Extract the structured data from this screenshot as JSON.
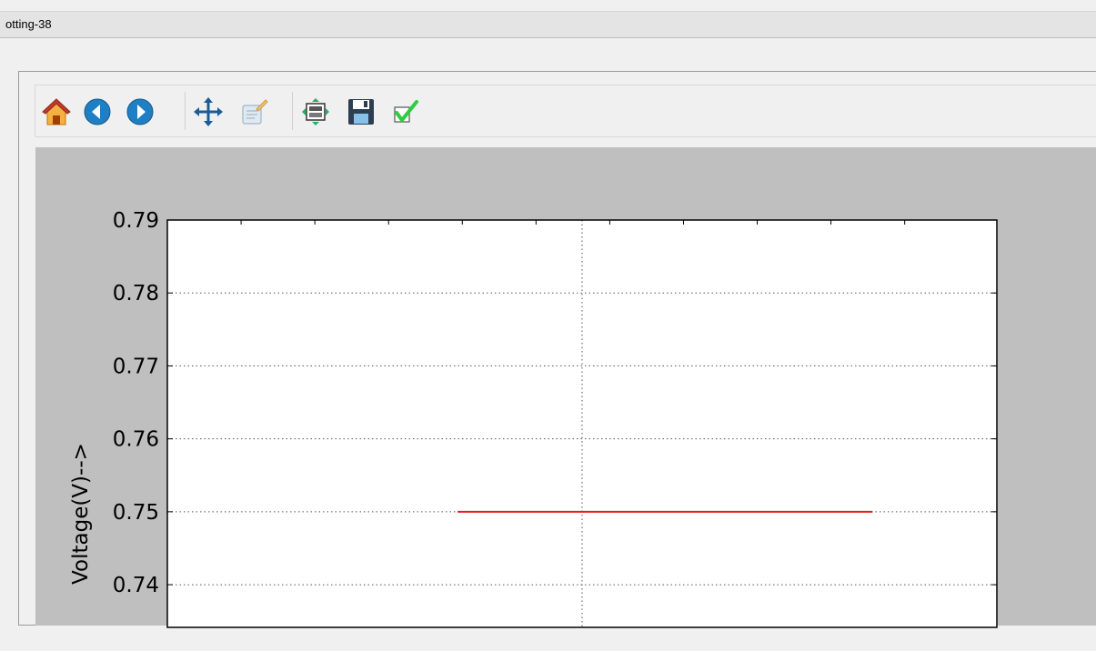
{
  "window": {
    "title": "otting-38"
  },
  "toolbar": {
    "buttons": [
      {
        "name": "home",
        "icon": "home-icon"
      },
      {
        "name": "back",
        "icon": "back-arrow-icon"
      },
      {
        "name": "forward",
        "icon": "forward-arrow-icon"
      },
      {
        "name": "pan",
        "icon": "move-icon"
      },
      {
        "name": "zoom",
        "icon": "zoom-to-rect-icon"
      },
      {
        "name": "subplots",
        "icon": "configure-subplots-icon"
      },
      {
        "name": "save",
        "icon": "floppy-disk-icon"
      },
      {
        "name": "edit-parameters",
        "icon": "checkmark-icon"
      }
    ]
  },
  "colors": {
    "canvas_bg": "#bfbfbf",
    "axes_bg": "#ffffff",
    "line": "#e8191c",
    "grid": "#555555"
  },
  "chart_data": {
    "type": "line",
    "title": "",
    "xlabel": "",
    "ylabel": "Voltage(V)-->",
    "ylim": [
      0.7344,
      0.79
    ],
    "xlim": [
      0,
      1
    ],
    "ytick_labels": [
      "0.79",
      "0.78",
      "0.77",
      "0.76",
      "0.75",
      "0.74"
    ],
    "ytick_values": [
      0.79,
      0.78,
      0.77,
      0.76,
      0.75,
      0.74
    ],
    "grid": true,
    "series": [
      {
        "x": [
          0.35,
          0.85
        ],
        "y": [
          0.75,
          0.75
        ]
      }
    ]
  }
}
